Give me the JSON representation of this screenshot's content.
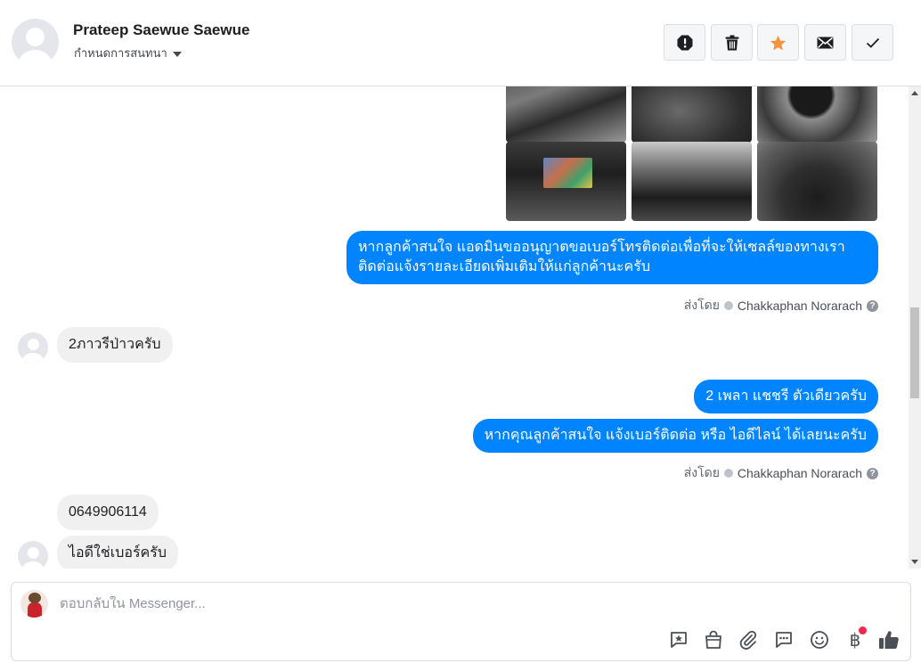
{
  "header": {
    "contact_name": "Prateep Saewue Saewue",
    "conversation_settings_label": "กำหนดการสนทนา",
    "actions": [
      "report-spam",
      "delete",
      "star",
      "mark-unread",
      "mark-done"
    ]
  },
  "messages": {
    "outgoing_1": {
      "line1": "หากลูกค้าสนใจ แอดมินขออนุญาตขอเบอร์โทรติดต่อเพื่อที่จะให้เซลล์ของทางเรา",
      "line2": "ติดต่อแจ้งรายละเอียดเพิ่มเติมให้แก่ลูกค้านะครับ"
    },
    "sent_by_1": {
      "prefix": "ส่งโดย",
      "agent": "Chakkaphan Norarach",
      "help": "?"
    },
    "incoming_1": "2ภาวรีป่าวครับ",
    "outgoing_2": "2 เพลา แชชรี ตัวเดียวครับ",
    "outgoing_3": "หากคุณลูกค้าสนใจ แจ้งเบอร์ติดต่อ หรือ ไอดีไลน์ ได้เลยนะครับ",
    "sent_by_2": {
      "prefix": "ส่งโดย",
      "agent": "Chakkaphan Norarach",
      "help": "?"
    },
    "incoming_2": "0649906114",
    "incoming_3": "ไอดีใช่เบอร์ครับ"
  },
  "composer": {
    "placeholder": "ตอบกลับใน Messenger...",
    "baht_symbol": "฿",
    "tools": [
      "sticker-reply",
      "shop-bag",
      "attachment",
      "saved-replies",
      "emoji",
      "payment",
      "like"
    ]
  },
  "colors": {
    "outgoing_bubble": "#0084ff",
    "incoming_bubble": "#f0f0f0",
    "star": "#f7923b",
    "notification_dot": "#f02849"
  }
}
